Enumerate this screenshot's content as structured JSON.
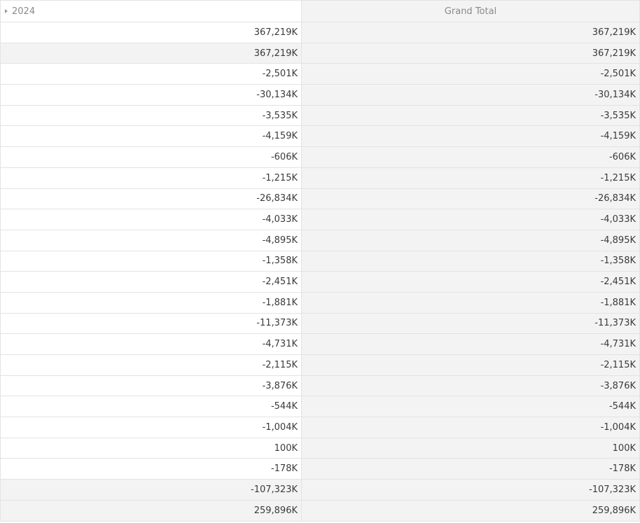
{
  "header": {
    "year_label": "2024",
    "total_label": "Grand Total"
  },
  "rows": [
    {
      "year": "367,219K",
      "total": "367,219K"
    },
    {
      "year": "367,219K",
      "total": "367,219K"
    },
    {
      "year": "-2,501K",
      "total": "-2,501K"
    },
    {
      "year": "-30,134K",
      "total": "-30,134K"
    },
    {
      "year": "-3,535K",
      "total": "-3,535K"
    },
    {
      "year": "-4,159K",
      "total": "-4,159K"
    },
    {
      "year": "-606K",
      "total": "-606K"
    },
    {
      "year": "-1,215K",
      "total": "-1,215K"
    },
    {
      "year": "-26,834K",
      "total": "-26,834K"
    },
    {
      "year": "-4,033K",
      "total": "-4,033K"
    },
    {
      "year": "-4,895K",
      "total": "-4,895K"
    },
    {
      "year": "-1,358K",
      "total": "-1,358K"
    },
    {
      "year": "-2,451K",
      "total": "-2,451K"
    },
    {
      "year": "-1,881K",
      "total": "-1,881K"
    },
    {
      "year": "-11,373K",
      "total": "-11,373K"
    },
    {
      "year": "-4,731K",
      "total": "-4,731K"
    },
    {
      "year": "-2,115K",
      "total": "-2,115K"
    },
    {
      "year": "-3,876K",
      "total": "-3,876K"
    },
    {
      "year": "-544K",
      "total": "-544K"
    },
    {
      "year": "-1,004K",
      "total": "-1,004K"
    },
    {
      "year": "100K",
      "total": "100K"
    },
    {
      "year": "-178K",
      "total": "-178K"
    },
    {
      "year": "-107,323K",
      "total": "-107,323K"
    },
    {
      "year": "259,896K",
      "total": "259,896K"
    }
  ]
}
